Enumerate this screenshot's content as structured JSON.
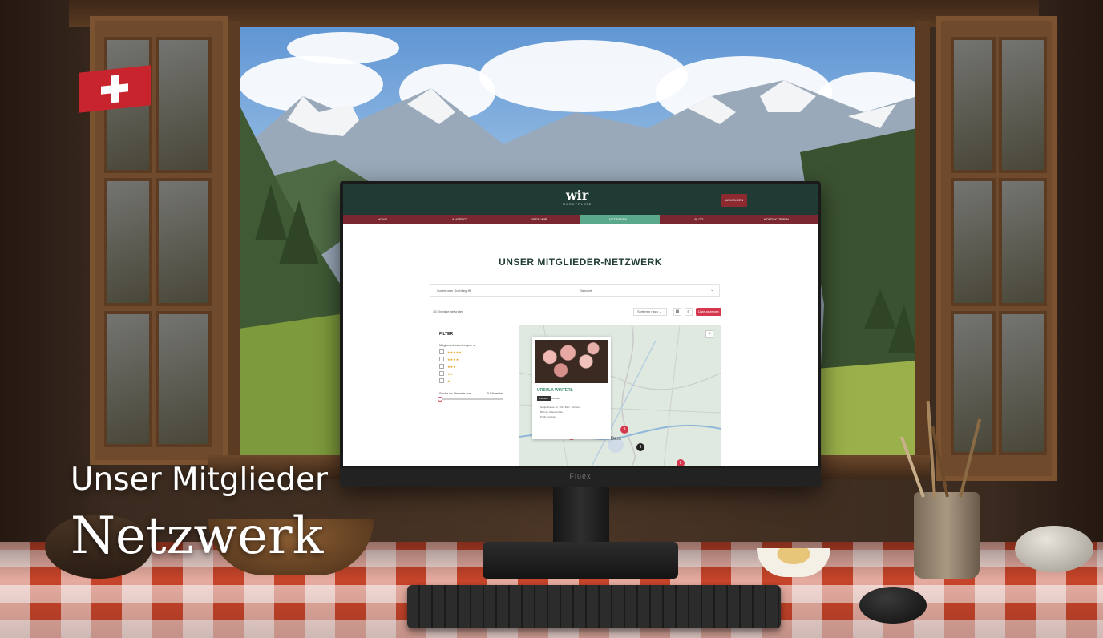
{
  "overlay": {
    "title_line1": "Unser Mitglieder",
    "title_line2": "Netzwerk"
  },
  "monitor": {
    "brand": "Fiuex"
  },
  "site": {
    "logo_main": "wir",
    "logo_sub": "MARKTPLATZ",
    "login_button": "ANMELDEN",
    "nav": [
      {
        "label": "HOME",
        "active": false
      },
      {
        "label": "ANGEBOT ⌄",
        "active": false
      },
      {
        "label": "ÜBER WIR ⌄",
        "active": false
      },
      {
        "label": "NETZWERK ⌄",
        "active": true
      },
      {
        "label": "BLOG",
        "active": false
      },
      {
        "label": "KONTAKTIEREN ⌄",
        "active": false
      }
    ],
    "page_title": "UNSER MITGLIEDER-NETZWERK",
    "search": {
      "placeholder": "Suche oder Suchbegriff",
      "location": "Standort",
      "chevron": "⌄"
    },
    "results_text": "36 Einträge gefunden",
    "sort_label": "Sortieren nach ⌄",
    "view_grid_icon": "grid-icon",
    "view_list_icon": "list-icon",
    "list_button": "Liste anzeigen",
    "filter": {
      "title": "FILTER",
      "rating_label": "Mitgliederbewertungen ⌄",
      "ratings": [
        "★★★★★",
        "★★★★",
        "★★★",
        "★★",
        "★"
      ],
      "distance_label": "Suche im Umkreis von",
      "distance_value": "0 Kilometer"
    },
    "map": {
      "close_icon": "close-icon",
      "city_label": "Bern",
      "card": {
        "name": "URSULA WINTERL",
        "tag": "Floristin",
        "tag2": "Blumen",
        "line1": "Hauptstrasse 12, 3011 Bern, Schweiz",
        "line2": "Blumen & Gartenbau",
        "line3": "Profil ansehen"
      },
      "pins": [
        "9",
        "9",
        "9",
        "9"
      ]
    }
  },
  "colors": {
    "header_green": "#1f3b33",
    "nav_maroon": "#7a2731",
    "nav_active": "#5aa98c",
    "accent_red": "#d5384e",
    "card_name": "#3d8d70"
  }
}
